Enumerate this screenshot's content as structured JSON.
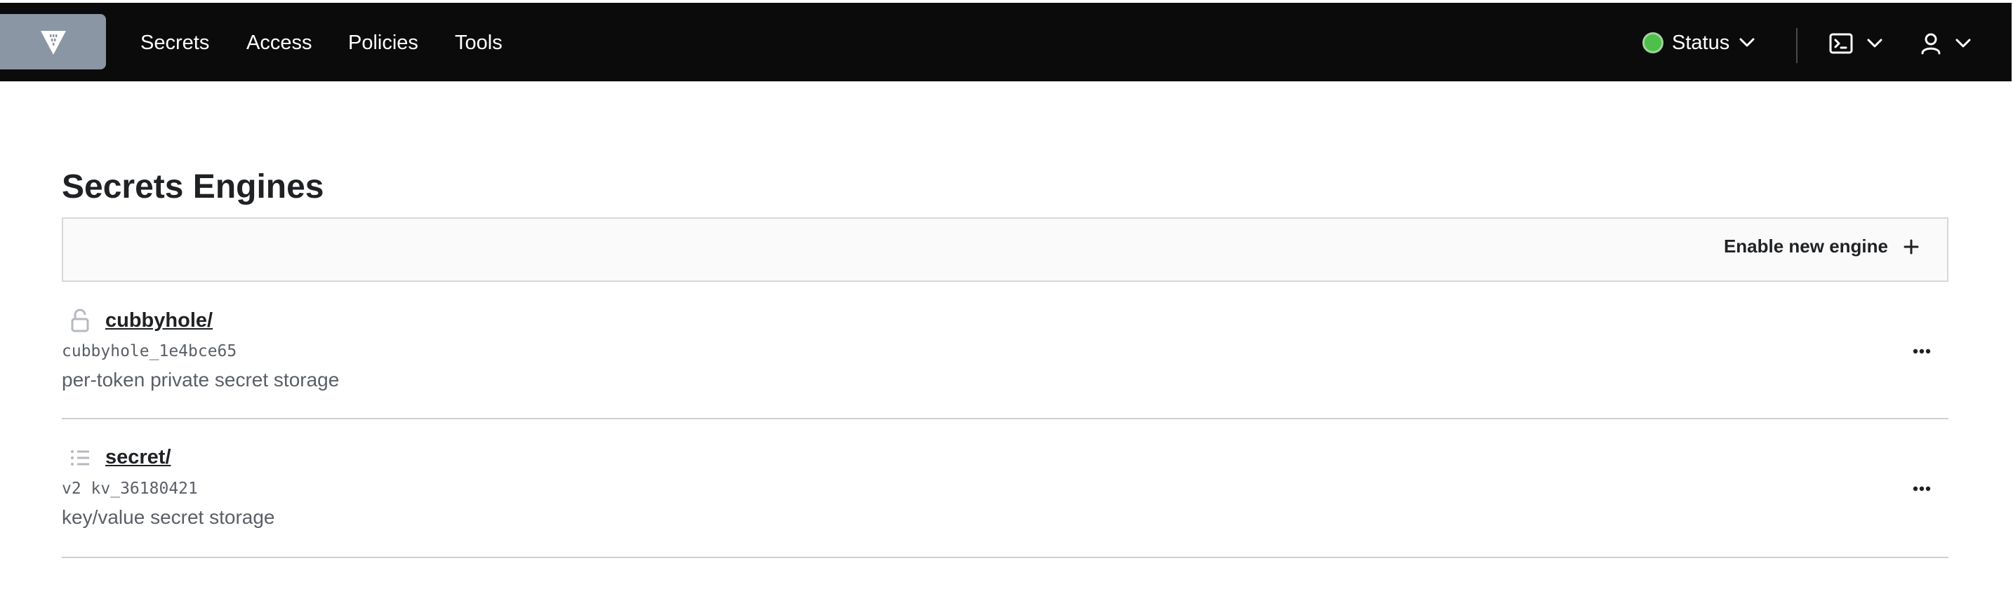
{
  "nav": {
    "logo_icon": "vault-logo-icon",
    "links": [
      "Secrets",
      "Access",
      "Policies",
      "Tools"
    ],
    "status_label": "Status",
    "status_color": "#4fbf4c",
    "console_icon": "terminal-icon",
    "user_icon": "user-icon"
  },
  "page": {
    "title": "Secrets Engines",
    "enable_label": "Enable new engine"
  },
  "engines": [
    {
      "icon": "lock-icon",
      "name": "cubbyhole/",
      "id": "cubbyhole_1e4bce65",
      "description": "per-token private secret storage"
    },
    {
      "icon": "list-icon",
      "name": "secret/",
      "id": "v2 kv_36180421",
      "description": "key/value secret storage"
    }
  ]
}
